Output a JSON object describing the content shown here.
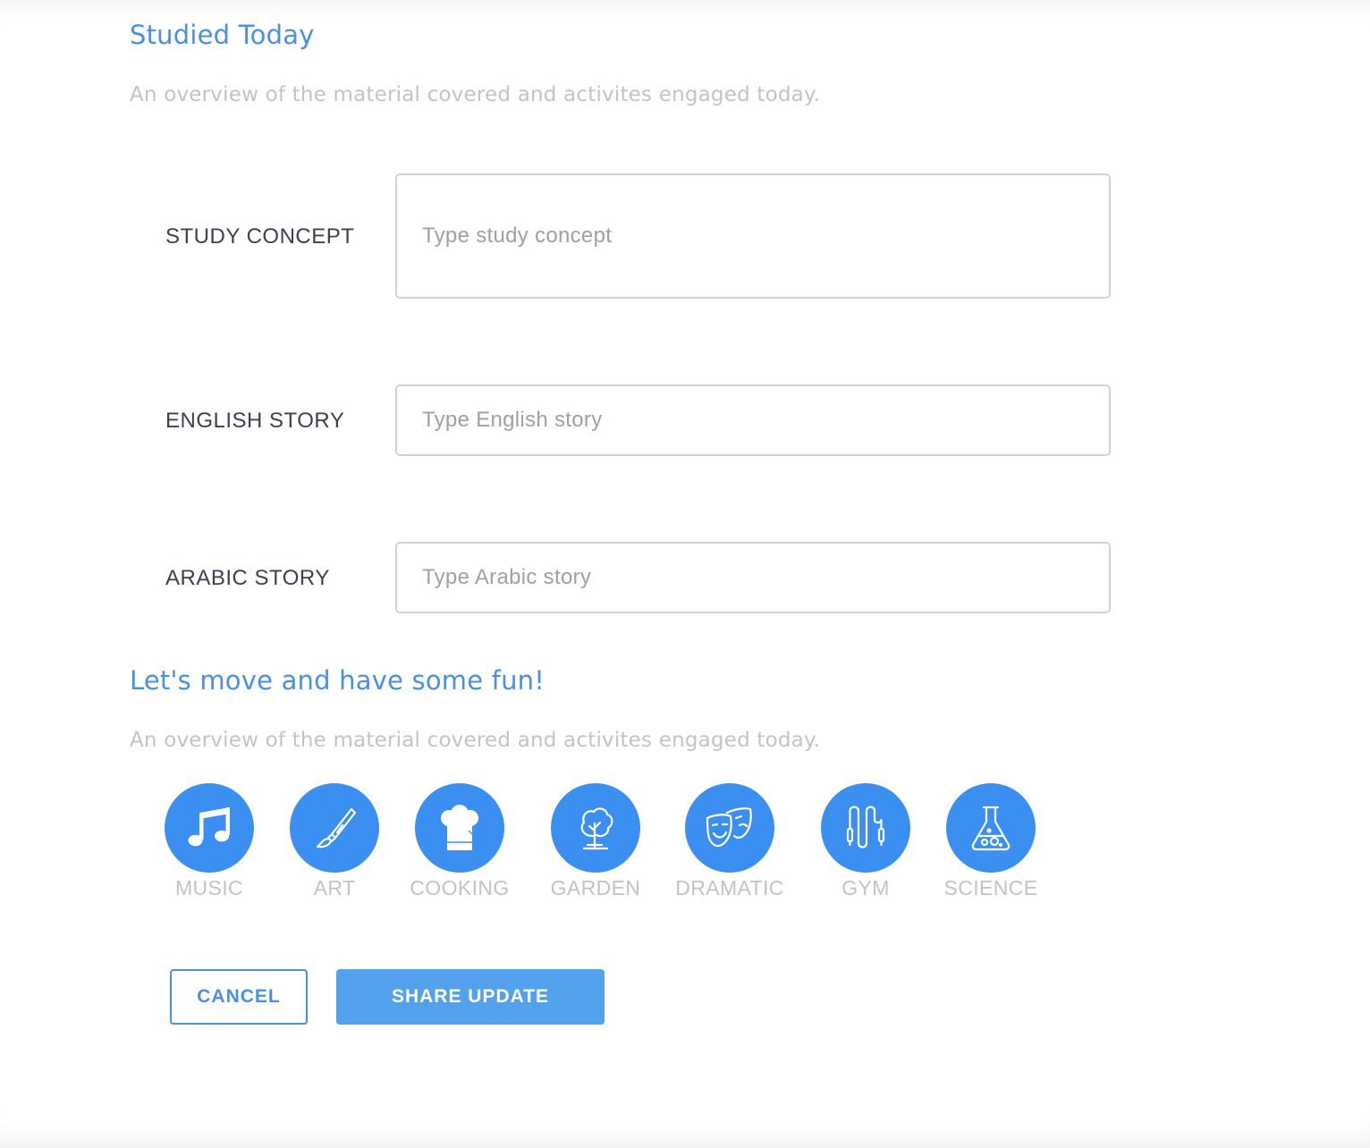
{
  "studied_today": {
    "title": "Studied Today",
    "subtitle": "An overview of the material covered and activites engaged today."
  },
  "fields": [
    {
      "label": "STUDY CONCEPT",
      "placeholder": "Type study concept",
      "value": ""
    },
    {
      "label": "ENGLISH STORY",
      "placeholder": "Type English story",
      "value": ""
    },
    {
      "label": "ARABIC STORY",
      "placeholder": "Type Arabic story",
      "value": ""
    }
  ],
  "fun": {
    "title": "Let's move and have some fun!",
    "subtitle": "An overview of the material covered and activites engaged today."
  },
  "activities": [
    {
      "label": "MUSIC",
      "icon": "music-note-icon"
    },
    {
      "label": "ART",
      "icon": "paintbrush-icon"
    },
    {
      "label": "COOKING",
      "icon": "chef-hat-icon"
    },
    {
      "label": "GARDEN",
      "icon": "tree-icon"
    },
    {
      "label": "DRAMATIC",
      "icon": "theater-masks-icon"
    },
    {
      "label": "GYM",
      "icon": "jump-rope-icon"
    },
    {
      "label": "SCIENCE",
      "icon": "flask-icon"
    }
  ],
  "actions": {
    "cancel_label": "CANCEL",
    "share_label": "SHARE UPDATE"
  },
  "colors": {
    "accent": "#4a90e2",
    "icon_circle": "#3a8ff0",
    "share_button": "#53a0ec",
    "muted_text": "#c3c3c6"
  }
}
